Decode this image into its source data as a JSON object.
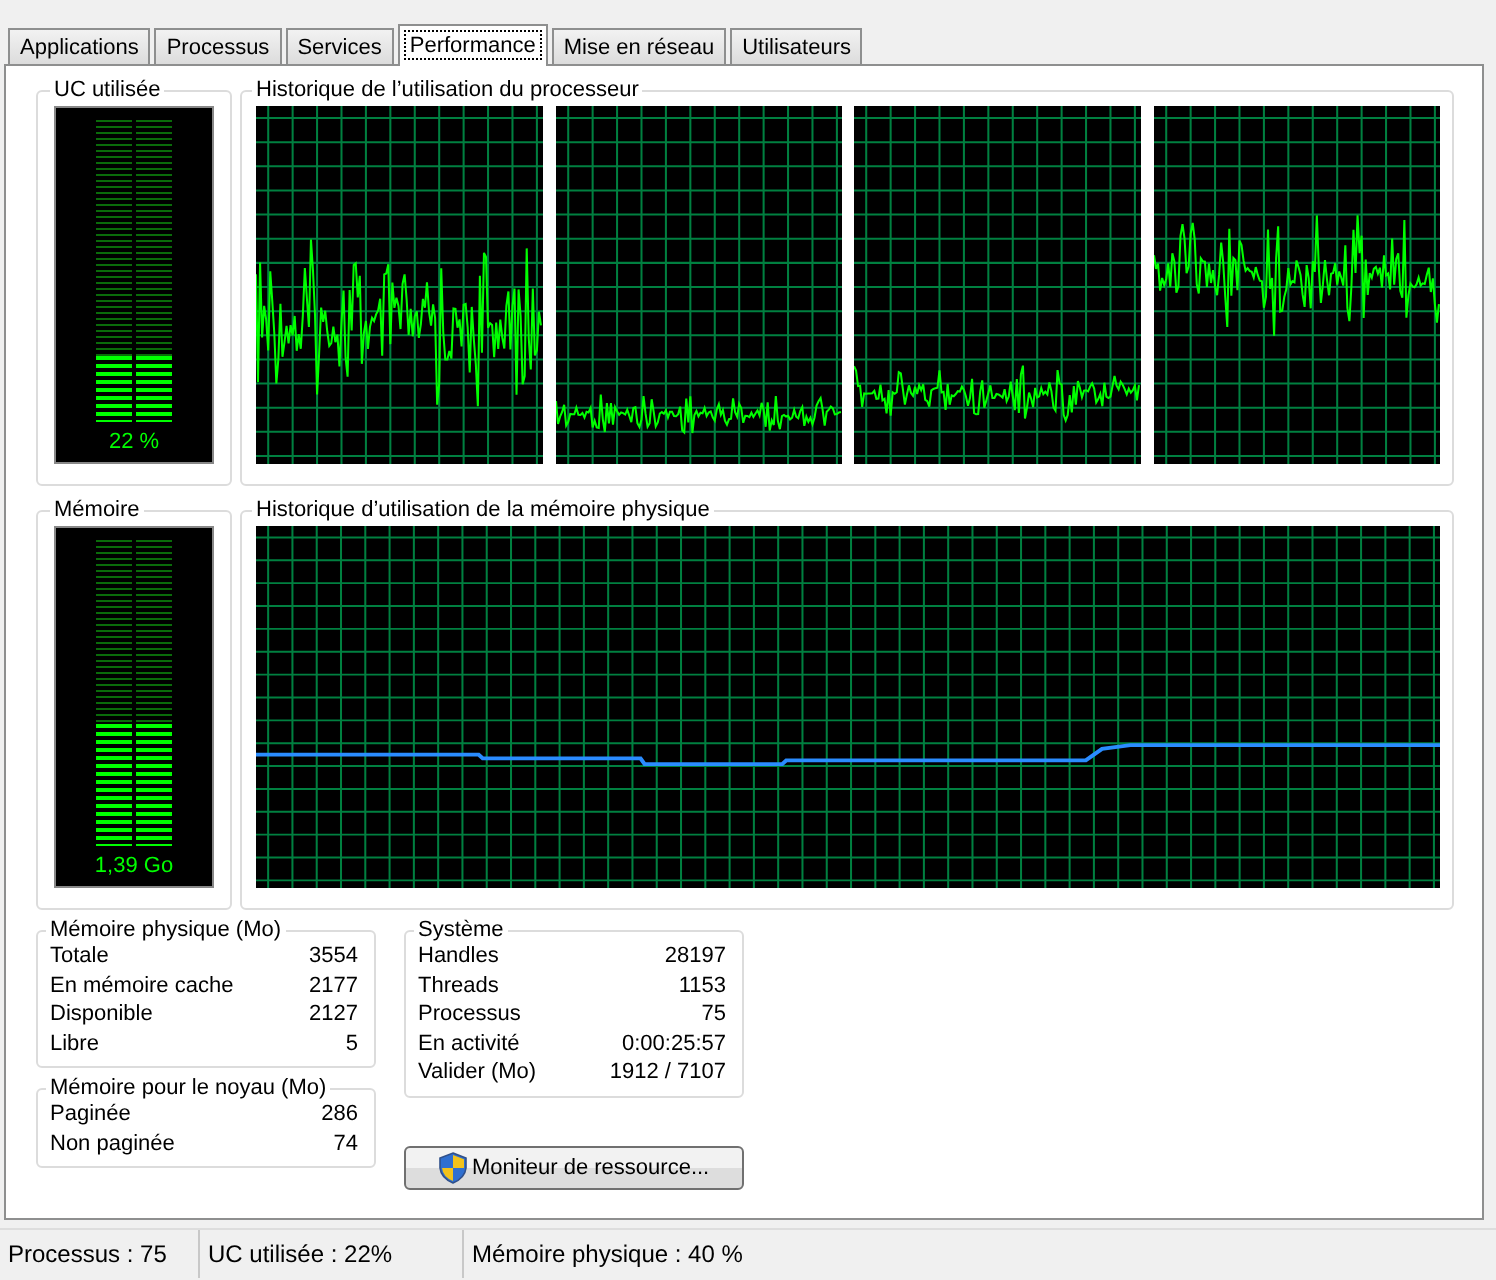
{
  "tabs": [
    {
      "label": "Applications",
      "selected": false
    },
    {
      "label": "Processus",
      "selected": false
    },
    {
      "label": "Services",
      "selected": false
    },
    {
      "label": "Performance",
      "selected": true
    },
    {
      "label": "Mise en réseau",
      "selected": false
    },
    {
      "label": "Utilisateurs",
      "selected": false
    }
  ],
  "cpu_usage": {
    "title": "UC utilisée",
    "level": 0.22,
    "reading": "22 %"
  },
  "cpu_history": {
    "title": "Historique de l’utilisation du processeur"
  },
  "memory": {
    "title": "Mémoire",
    "level": 0.4,
    "reading": "1,39 Go"
  },
  "memory_history": {
    "title": "Historique d’utilisation de la mémoire physique"
  },
  "physical_memory": {
    "title": "Mémoire physique (Mo)",
    "rows": [
      {
        "label": "Totale",
        "value": "3554"
      },
      {
        "label": "En mémoire cache",
        "value": "2177"
      },
      {
        "label": "Disponible",
        "value": "2127"
      },
      {
        "label": "Libre",
        "value": "5"
      }
    ]
  },
  "kernel_memory": {
    "title": "Mémoire pour le noyau (Mo)",
    "rows": [
      {
        "label": "Paginée",
        "value": "286"
      },
      {
        "label": "Non paginée",
        "value": "74"
      }
    ]
  },
  "system": {
    "title": "Système",
    "rows": [
      {
        "label": "Handles",
        "value": "28197"
      },
      {
        "label": "Threads",
        "value": "1153"
      },
      {
        "label": "Processus",
        "value": "75"
      },
      {
        "label": "En activité",
        "value": "0:00:25:57"
      },
      {
        "label": "Valider (Mo)",
        "value": "1912 / 7107"
      }
    ]
  },
  "resource_monitor_button": {
    "label": "Moniteur de ressource..."
  },
  "status_bar": [
    "Processus : 75",
    "UC utilisée : 22%",
    "Mémoire physique : 40 %"
  ]
}
